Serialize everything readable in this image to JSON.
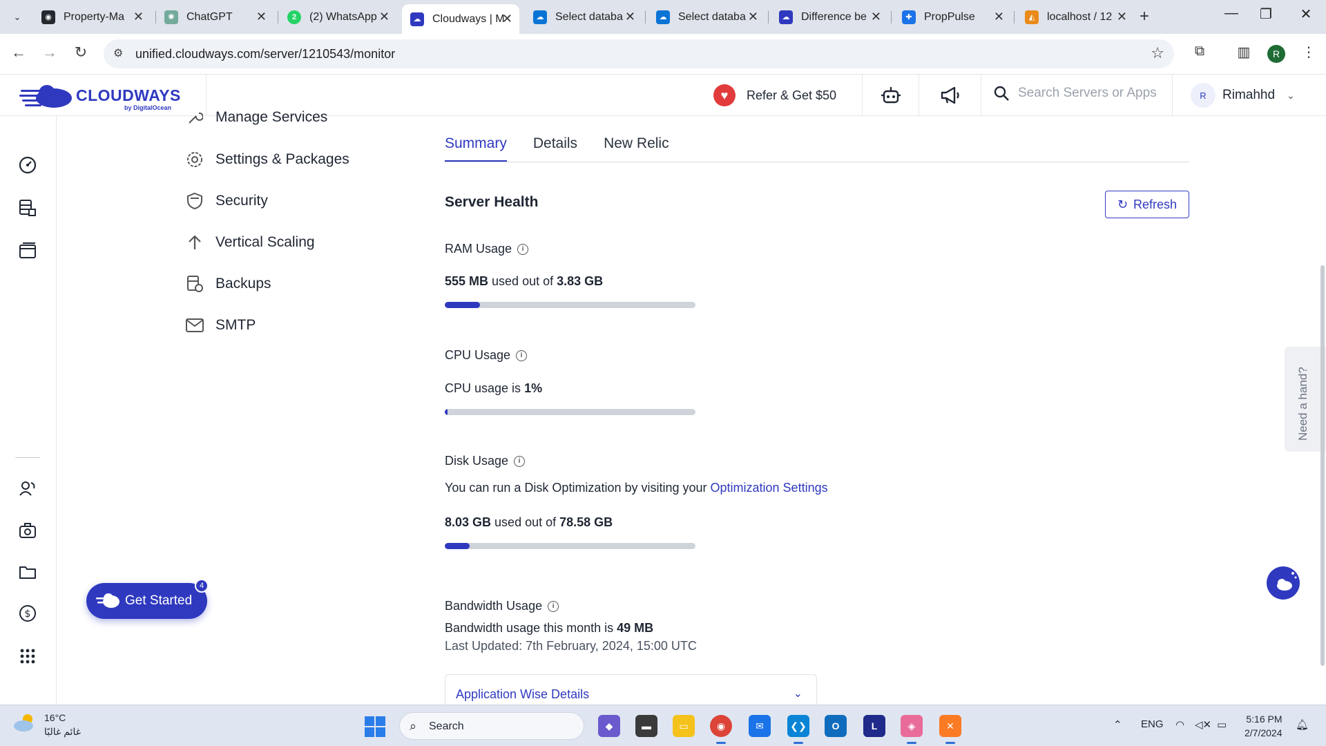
{
  "browser": {
    "tabs": [
      {
        "title": "Property-Ma",
        "favicon": "github-icon",
        "color": "#24292f"
      },
      {
        "title": "ChatGPT",
        "favicon": "chatgpt-icon",
        "color": "#74aa9c"
      },
      {
        "title": "(2) WhatsApp",
        "favicon": "whatsapp-icon",
        "color": "#25d366"
      },
      {
        "title": "Cloudways | M",
        "favicon": "cloudways-icon",
        "color": "#2f39bf"
      },
      {
        "title": "Select databa",
        "favicon": "azure-icon",
        "color": "#0a74d6"
      },
      {
        "title": "Select databa",
        "favicon": "azure-icon",
        "color": "#0a74d6"
      },
      {
        "title": "Difference be",
        "favicon": "cloudways-icon",
        "color": "#2f39bf"
      },
      {
        "title": "PropPulse",
        "favicon": "proppulse-icon",
        "color": "#1a73e8"
      },
      {
        "title": "localhost / 12",
        "favicon": "phpmyadmin-icon",
        "color": "#e98a1b"
      }
    ],
    "url": "unified.cloudways.com/server/1210543/monitor",
    "profile_initial": "R"
  },
  "header": {
    "brand": "CLOUDWAYS",
    "brand_sub": "by DigitalOcean",
    "refer_label": "Refer & Get $50",
    "search_placeholder": "Search Servers or Apps",
    "user_initial": "R",
    "username": "Rimahhd"
  },
  "subnav": {
    "items": [
      {
        "label": "Manage Services",
        "icon": "wrench-icon"
      },
      {
        "label": "Settings & Packages",
        "icon": "gear-icon"
      },
      {
        "label": "Security",
        "icon": "shield-icon"
      },
      {
        "label": "Vertical Scaling",
        "icon": "arrow-up-icon"
      },
      {
        "label": "Backups",
        "icon": "backup-icon"
      },
      {
        "label": "SMTP",
        "icon": "mail-icon"
      }
    ]
  },
  "get_started": {
    "label": "Get Started",
    "badge": "4"
  },
  "main": {
    "tabs": [
      {
        "label": "Summary",
        "active": true
      },
      {
        "label": "Details",
        "active": false
      },
      {
        "label": "New Relic",
        "active": false
      }
    ],
    "section_title": "Server Health",
    "refresh_label": "Refresh",
    "ram": {
      "title": "RAM Usage",
      "used": "555 MB",
      "middle": " used out of ",
      "total": "3.83 GB",
      "fraction": 0.14
    },
    "cpu": {
      "title": "CPU Usage",
      "prefix": "CPU usage is ",
      "value": "1%",
      "fraction": 0.01
    },
    "disk": {
      "title": "Disk Usage",
      "hint": "You can run a Disk Optimization by visiting your ",
      "hint_link": "Optimization Settings",
      "used": "8.03 GB",
      "middle": " used out of ",
      "total": "78.58 GB",
      "fraction": 0.1
    },
    "bandwidth": {
      "title": "Bandwidth Usage",
      "prefix": "Bandwidth usage this month is ",
      "value": "49 MB",
      "updated": "Last Updated: 7th February, 2024, 15:00 UTC"
    },
    "app_wise_label": "Application Wise Details"
  },
  "help": {
    "need_hand": "Need a hand?"
  },
  "taskbar": {
    "temperature": "16°C",
    "weather_text": "غائم غالبًا",
    "search_label": "Search",
    "language": "ENG",
    "time": "5:16 PM",
    "date": "2/7/2024"
  },
  "colors": {
    "accent": "#2f39bf",
    "track": "#cfd3da"
  }
}
